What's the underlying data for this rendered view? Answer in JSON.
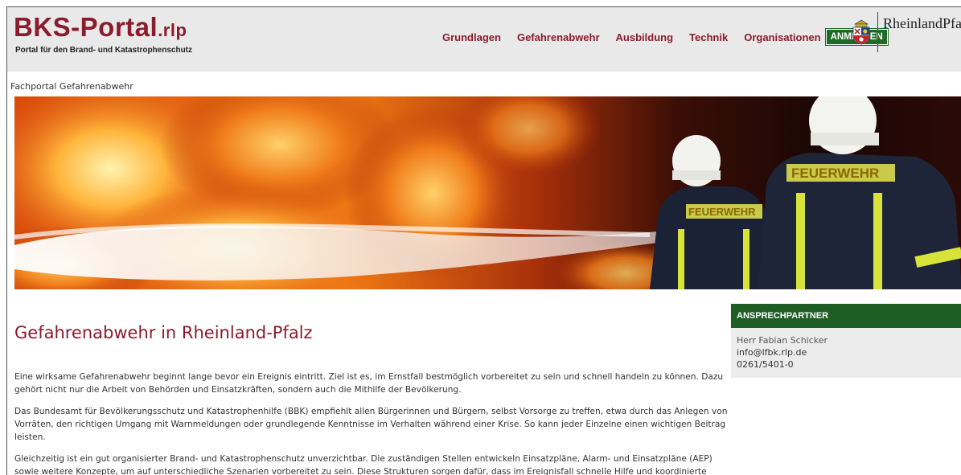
{
  "header": {
    "logo_main": "BKS-Portal",
    "logo_suffix": ".rlp",
    "logo_sub": "Portal für den Brand- und Katastrophenschutz",
    "nav": [
      "Grundlagen",
      "Gefahrenabwehr",
      "Ausbildung",
      "Technik",
      "Organisationen"
    ],
    "login_label": "ANMELDEN",
    "state_name": "RheinlandPfal"
  },
  "breadcrumb": "Fachportal Gefahrenabwehr",
  "hero": {
    "jacket_text": "FEUERWEHR"
  },
  "main": {
    "title": "Gefahrenabwehr in Rheinland-Pfalz",
    "paragraphs": [
      "Eine wirksame Gefahrenabwehr beginnt lange bevor ein Ereignis eintritt. Ziel ist es, im Ernstfall bestmöglich vorbereitet zu sein und schnell handeln zu können. Dazu gehört nicht nur die Arbeit von Behörden und Einsatzkräften, sondern auch die Mithilfe der Bevölkerung.",
      "Das Bundesamt für Bevölkerungsschutz und Katastrophenhilfe (BBK) empfiehlt allen Bürgerinnen und Bürgern, selbst Vorsorge zu treffen, etwa durch das Anlegen von Vorräten, den richtigen Umgang mit Warnmeldungen oder grundlegende Kenntnisse im Verhalten während einer Krise. So kann jeder Einzelne einen wichtigen Beitrag leisten.",
      "Gleichzeitig ist ein gut organisierter Brand- und Katastrophenschutz unverzichtbar. Die zuständigen Stellen entwickeln Einsatzpläne, Alarm- und Einsatzpläne (AEP) sowie weitere Konzepte, um auf unterschiedliche Szenarien vorbereitet zu sein. Diese Strukturen sorgen dafür, dass im Ereignisfall schnelle Hilfe und koordinierte Abläufe"
    ]
  },
  "contact": {
    "heading": "ANSPRECHPARTNER",
    "name": "Herr Fabian Schicker",
    "email": "info@lfbk.rlp.de",
    "phone": "0261/5401-0"
  },
  "colors": {
    "brand": "#8b1b2d",
    "green": "#1e6b27",
    "header_bg": "#e9e9e9"
  }
}
